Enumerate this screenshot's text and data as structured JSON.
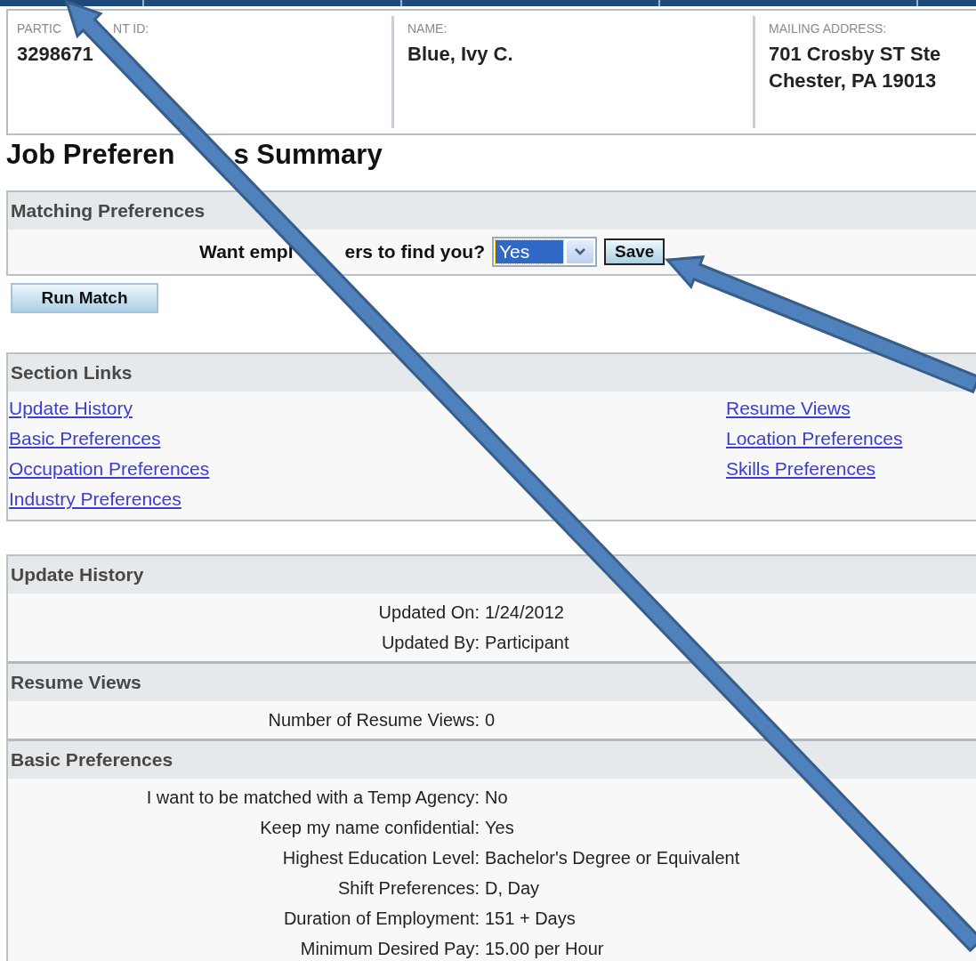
{
  "participant": [
    {
      "label": [
        "PARTIC",
        "NT ID:"
      ],
      "lines": [
        "3298671"
      ]
    },
    {
      "label": [
        "NAME:"
      ],
      "lines": [
        "Blue, Ivy C."
      ]
    },
    {
      "label": [
        "MAILING ADDRESS:"
      ],
      "lines": [
        "701 Crosby ST Ste",
        "Chester, PA 19013"
      ]
    }
  ],
  "title": [
    "Job Preferen",
    "s Summary"
  ],
  "matching": {
    "header": "Matching Preferences",
    "question": [
      "Want empl",
      "ers to find you?"
    ],
    "select": {
      "value": "Yes",
      "focused": true
    },
    "save": "Save",
    "run_match": "Run Match"
  },
  "section_links": {
    "header": "Section Links",
    "left": [
      "Update History",
      "Basic Preferences",
      "Occupation Preferences",
      "Industry Preferences"
    ],
    "right": [
      "Resume Views",
      "Location Preferences",
      "Skills Preferences"
    ]
  },
  "sections": [
    {
      "header": "Update History",
      "rows": [
        {
          "label": "Updated On:",
          "value": "1/24/2012"
        },
        {
          "label": "Updated By:",
          "value": "Participant"
        }
      ]
    },
    {
      "header": "Resume Views",
      "rows": [
        {
          "label": "Number of Resume Views:",
          "value": "0"
        }
      ]
    },
    {
      "header": "Basic Preferences",
      "rows": [
        {
          "label": "I want to be matched with a Temp Agency:",
          "value": "No"
        },
        {
          "label": "Keep my name confidential:",
          "value": "Yes"
        },
        {
          "label": "Highest Education Level:",
          "value": "Bachelor's Degree or Equivalent"
        },
        {
          "label": "Shift Preferences:",
          "value": "D, Day"
        },
        {
          "label": "Duration of Employment:",
          "value": "151 + Days"
        },
        {
          "label": "Minimum Desired Pay:",
          "value": "15.00 per Hour"
        }
      ]
    }
  ]
}
